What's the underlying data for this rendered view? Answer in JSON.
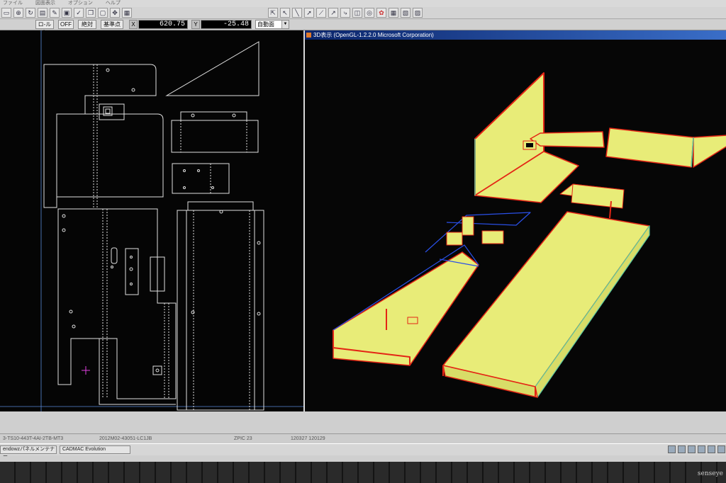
{
  "menubar": {
    "items": [
      "ファイル",
      "図面表示",
      "オプション",
      "ヘルプ"
    ]
  },
  "toolbar": {
    "left_icons": [
      "new-icon",
      "zoom-icon",
      "rotate-icon",
      "edit-icon",
      "pencil-icon",
      "lock-icon",
      "check-icon",
      "copy-icon",
      "frame-icon",
      "move-icon",
      "grid-icon"
    ],
    "right_icons": [
      "select-icon",
      "cursor-icon",
      "line-icon",
      "arrow-icon",
      "knife-icon",
      "diagonal-icon",
      "bend-icon",
      "view-icon",
      "target-icon",
      "color-icon",
      "grid-icon",
      "layers-icon",
      "layers2-icon"
    ]
  },
  "coordbar": {
    "btn_lock": "ロ-ルト",
    "btn_off": "OFF",
    "btn_absolute": "絶対",
    "btn_snap": "基準点",
    "x_label": "X",
    "x_value": "620.75",
    "y_label": "Y",
    "y_value": "-25.48",
    "mode_value": "自動面"
  },
  "view3d": {
    "title": "3D表示 (OpenGL-1.2.2.0 Microsoft Corporation)"
  },
  "statusbar": {
    "file": "3-TS10-443T-4AI-2TB-MT3",
    "drawing": "2012M02-43051-LC1JB",
    "scale": "ZPIC 23",
    "date": "120327 120129"
  },
  "taskbar": {
    "task1": "endowzパネルメンテナー",
    "task2": "CADMAC Evolution"
  },
  "colors": {
    "part_face": "#e8ec78",
    "part_edge": "#e42515",
    "part_edge_alt": "#58c8a0",
    "outline": "#2a50e8",
    "cad_line": "#e0e0e0",
    "cad_marker": "#e040e0"
  },
  "watermark": "senseye"
}
